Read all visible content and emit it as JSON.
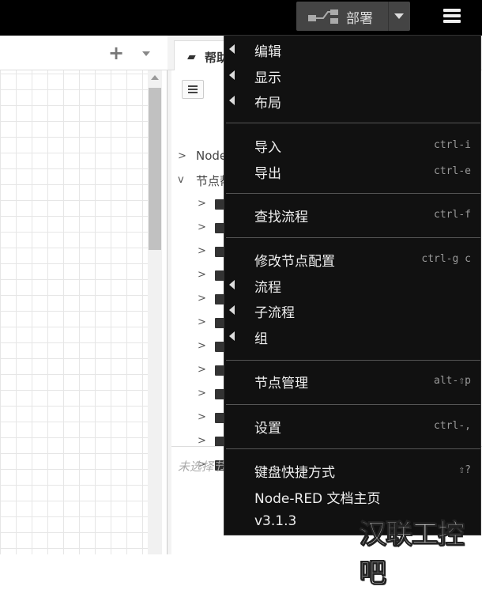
{
  "header": {
    "deploy_label": "部署",
    "deploy_icon": "deploy-flow-icon",
    "menu_icon": "hamburger-menu-icon"
  },
  "workspace": {
    "add_flow_icon": "plus-icon",
    "tabs_menu_icon": "chevron-down-icon"
  },
  "sidebar": {
    "tab_label": "帮助",
    "tab_icon": "book-icon",
    "tree": [
      {
        "label": "Node-RED",
        "expanded": false
      },
      {
        "label": "节点帮助",
        "expanded": true
      }
    ],
    "node_count": 12,
    "empty_text": "未选择节点"
  },
  "menu": {
    "items": [
      {
        "label": "编辑",
        "submenu": true,
        "shortcut": ""
      },
      {
        "label": "显示",
        "submenu": true,
        "shortcut": ""
      },
      {
        "label": "布局",
        "submenu": true,
        "shortcut": ""
      },
      {
        "label": "导入",
        "submenu": false,
        "shortcut": "ctrl-i"
      },
      {
        "label": "导出",
        "submenu": false,
        "shortcut": "ctrl-e"
      },
      {
        "label": "查找流程",
        "submenu": false,
        "shortcut": "ctrl-f"
      },
      {
        "label": "修改节点配置",
        "submenu": false,
        "shortcut": "ctrl-g c"
      },
      {
        "label": "流程",
        "submenu": true,
        "shortcut": ""
      },
      {
        "label": "子流程",
        "submenu": true,
        "shortcut": ""
      },
      {
        "label": "组",
        "submenu": true,
        "shortcut": ""
      },
      {
        "label": "节点管理",
        "submenu": false,
        "shortcut": "alt-⇧p"
      },
      {
        "label": "设置",
        "submenu": false,
        "shortcut": "ctrl-,"
      },
      {
        "label": "键盘快捷方式",
        "submenu": false,
        "shortcut": "⇧?"
      },
      {
        "label": "Node-RED 文档主页",
        "submenu": false,
        "shortcut": ""
      },
      {
        "label": "v3.1.3",
        "submenu": false,
        "shortcut": ""
      }
    ]
  },
  "watermark": "汉联工控吧"
}
